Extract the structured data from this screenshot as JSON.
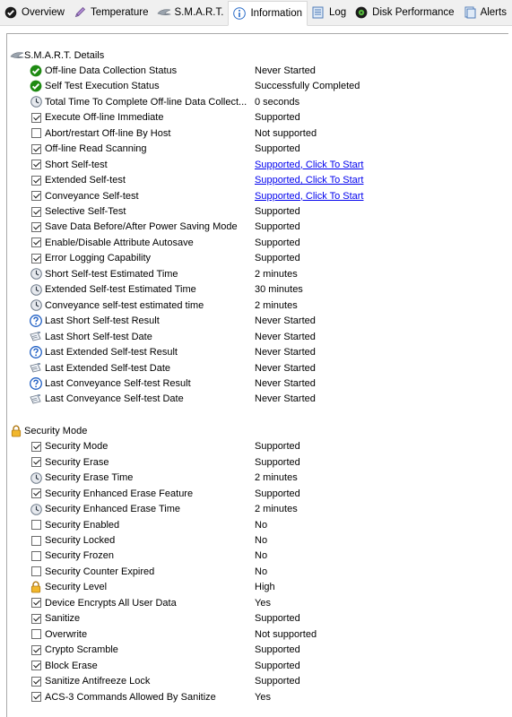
{
  "tabs": [
    {
      "label": "Overview",
      "icon": "check-circle-icon",
      "active": false
    },
    {
      "label": "Temperature",
      "icon": "thermometer-icon",
      "active": false
    },
    {
      "label": "S.M.A.R.T.",
      "icon": "smart-wing-icon",
      "active": false
    },
    {
      "label": "Information",
      "icon": "info-icon",
      "active": true
    },
    {
      "label": "Log",
      "icon": "log-icon",
      "active": false
    },
    {
      "label": "Disk Performance",
      "icon": "disk-performance-icon",
      "active": false
    },
    {
      "label": "Alerts",
      "icon": "alerts-icon",
      "active": false
    }
  ],
  "smart_section": {
    "title": "S.M.A.R.T. Details",
    "icon": "smart-wing-icon",
    "rows": [
      {
        "label": "Off-line Data Collection Status",
        "value": "Never Started",
        "icon": "green-check-icon"
      },
      {
        "label": "Self Test Execution Status",
        "value": "Successfully Completed",
        "icon": "green-check-icon"
      },
      {
        "label": "Total Time To Complete Off-line Data Collect...",
        "value": "0 seconds",
        "icon": "clock-icon"
      },
      {
        "label": "Execute Off-line Immediate",
        "value": "Supported",
        "icon": "checkbox-checked"
      },
      {
        "label": "Abort/restart Off-line By Host",
        "value": "Not supported",
        "icon": "checkbox-unchecked"
      },
      {
        "label": "Off-line Read Scanning",
        "value": "Supported",
        "icon": "checkbox-checked"
      },
      {
        "label": "Short Self-test",
        "value": "Supported, Click To Start",
        "icon": "checkbox-checked",
        "link": true
      },
      {
        "label": "Extended Self-test",
        "value": "Supported, Click To Start",
        "icon": "checkbox-checked",
        "link": true
      },
      {
        "label": "Conveyance Self-test",
        "value": "Supported, Click To Start",
        "icon": "checkbox-checked",
        "link": true
      },
      {
        "label": "Selective Self-Test",
        "value": "Supported",
        "icon": "checkbox-checked"
      },
      {
        "label": "Save Data Before/After Power Saving Mode",
        "value": "Supported",
        "icon": "checkbox-checked"
      },
      {
        "label": "Enable/Disable Attribute Autosave",
        "value": "Supported",
        "icon": "checkbox-checked"
      },
      {
        "label": "Error Logging Capability",
        "value": "Supported",
        "icon": "checkbox-checked"
      },
      {
        "label": "Short Self-test Estimated Time",
        "value": "2 minutes",
        "icon": "clock-icon"
      },
      {
        "label": "Extended Self-test Estimated Time",
        "value": "30 minutes",
        "icon": "clock-icon"
      },
      {
        "label": "Conveyance self-test estimated time",
        "value": "2 minutes",
        "icon": "clock-icon"
      },
      {
        "label": "Last Short Self-test Result",
        "value": "Never Started",
        "icon": "question-icon"
      },
      {
        "label": "Last Short Self-test Date",
        "value": "Never Started",
        "icon": "calendar-icon"
      },
      {
        "label": "Last Extended Self-test Result",
        "value": "Never Started",
        "icon": "question-icon"
      },
      {
        "label": "Last Extended Self-test Date",
        "value": "Never Started",
        "icon": "calendar-icon"
      },
      {
        "label": "Last Conveyance Self-test Result",
        "value": "Never Started",
        "icon": "question-icon"
      },
      {
        "label": "Last Conveyance Self-test Date",
        "value": "Never Started",
        "icon": "calendar-icon"
      }
    ]
  },
  "security_section": {
    "title": "Security Mode",
    "icon": "padlock-icon",
    "rows": [
      {
        "label": "Security Mode",
        "value": "Supported",
        "icon": "checkbox-checked"
      },
      {
        "label": "Security Erase",
        "value": "Supported",
        "icon": "checkbox-checked"
      },
      {
        "label": "Security Erase Time",
        "value": "2 minutes",
        "icon": "clock-icon"
      },
      {
        "label": "Security Enhanced Erase Feature",
        "value": "Supported",
        "icon": "checkbox-checked"
      },
      {
        "label": "Security Enhanced Erase Time",
        "value": "2 minutes",
        "icon": "clock-icon"
      },
      {
        "label": "Security Enabled",
        "value": "No",
        "icon": "checkbox-unchecked"
      },
      {
        "label": "Security Locked",
        "value": "No",
        "icon": "checkbox-unchecked"
      },
      {
        "label": "Security Frozen",
        "value": "No",
        "icon": "checkbox-unchecked"
      },
      {
        "label": "Security Counter Expired",
        "value": "No",
        "icon": "checkbox-unchecked"
      },
      {
        "label": "Security Level",
        "value": "High",
        "icon": "padlock-icon"
      },
      {
        "label": "Device Encrypts All User Data",
        "value": "Yes",
        "icon": "checkbox-checked"
      },
      {
        "label": "Sanitize",
        "value": "Supported",
        "icon": "checkbox-checked"
      },
      {
        "label": "Overwrite",
        "value": "Not supported",
        "icon": "checkbox-unchecked"
      },
      {
        "label": "Crypto Scramble",
        "value": "Supported",
        "icon": "checkbox-checked"
      },
      {
        "label": "Block Erase",
        "value": "Supported",
        "icon": "checkbox-checked"
      },
      {
        "label": "Sanitize Antifreeze Lock",
        "value": "Supported",
        "icon": "checkbox-checked"
      },
      {
        "label": "ACS-3 Commands Allowed By Sanitize",
        "value": "Yes",
        "icon": "checkbox-checked"
      }
    ]
  },
  "colors": {
    "link": "#0000ee",
    "green": "#2e9a1e",
    "clock": "#7d8b9c",
    "question": "#1f5fc4",
    "padlock": "#e0a21e"
  }
}
